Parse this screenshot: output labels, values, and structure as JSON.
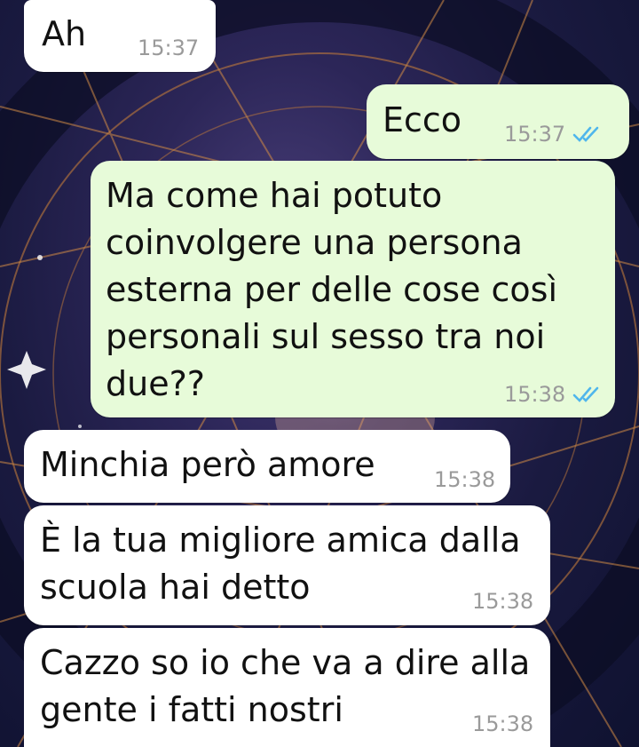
{
  "colors": {
    "incoming_bubble": "#ffffff",
    "outgoing_bubble": "#e7fbd9",
    "time_text": "#9a9a9a",
    "read_tick": "#4fb6ec"
  },
  "messages": [
    {
      "direction": "incoming",
      "text": "Ah",
      "time": "15:37"
    },
    {
      "direction": "outgoing",
      "text": "Ecco",
      "time": "15:37",
      "status": "read-ticks-icon"
    },
    {
      "direction": "outgoing",
      "text": "Ma come hai potuto\ncoinvolgere una persona\nesterna per delle cose così\npersonali sul sesso tra noi\ndue??",
      "time": "15:38",
      "status": "read-ticks-icon"
    },
    {
      "direction": "incoming",
      "text": "Minchia però amore",
      "time": "15:38"
    },
    {
      "direction": "incoming",
      "text": "È la tua migliore amica dalla\nscuola hai detto",
      "time": "15:38"
    },
    {
      "direction": "incoming",
      "text": "Cazzo so io che va a dire alla\ngente i fatti nostri",
      "time": "15:38"
    }
  ]
}
